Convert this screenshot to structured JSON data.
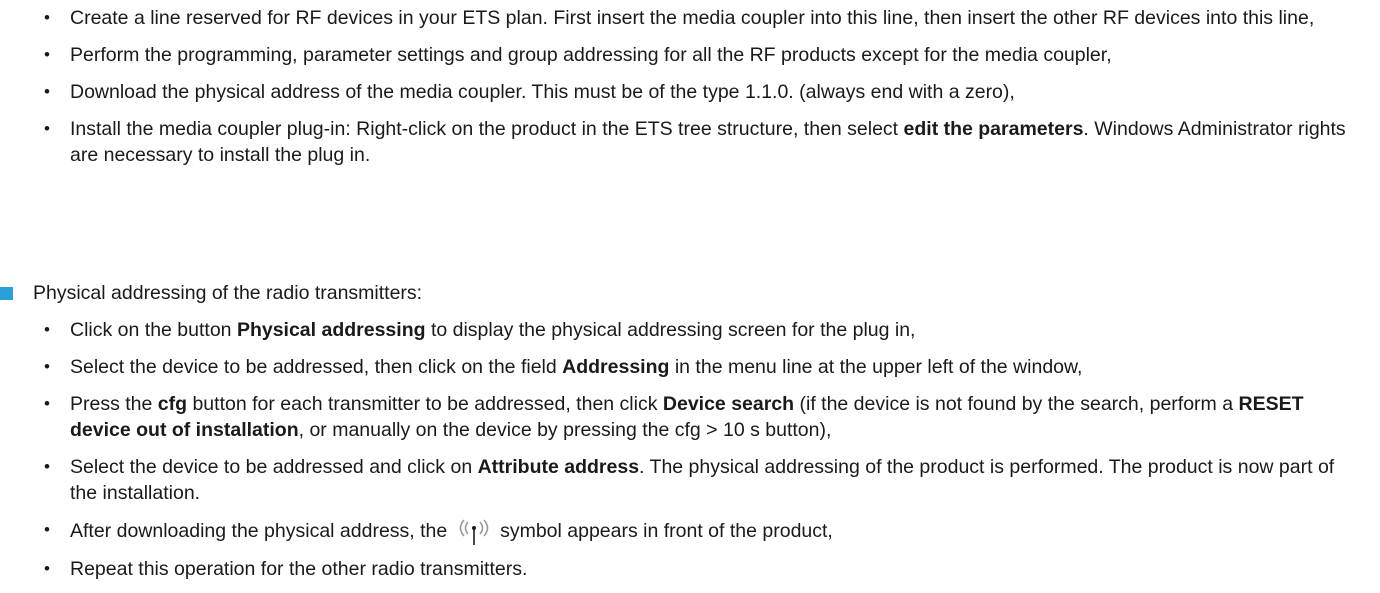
{
  "bullet_char": "•",
  "top_list": [
    {
      "parts": [
        {
          "t": "Create a line reserved for RF devices in your ETS plan. First insert the media coupler into this line, then insert the other RF devices into this line,",
          "b": false
        }
      ]
    },
    {
      "parts": [
        {
          "t": "Perform the programming, parameter settings and group addressing for all the RF products except for the media coupler,",
          "b": false
        }
      ]
    },
    {
      "parts": [
        {
          "t": "Download the physical address of the media coupler. This must be of the type 1.1.0. (always end with a zero),",
          "b": false
        }
      ]
    },
    {
      "parts": [
        {
          "t": "Install the media coupler plug-in: Right-click on the product in the ETS tree structure, then select ",
          "b": false
        },
        {
          "t": "edit the parameters",
          "b": true
        },
        {
          "t": ". Windows Administrator rights are necessary to install the plug in.",
          "b": false
        }
      ]
    }
  ],
  "section": {
    "heading": "Physical addressing of the radio transmitters:",
    "square_color": "#2a9fd8",
    "items": [
      {
        "parts": [
          {
            "t": "Click on the button ",
            "b": false
          },
          {
            "t": "Physical addressing",
            "b": true
          },
          {
            "t": " to display the physical addressing screen for the plug in,",
            "b": false
          }
        ]
      },
      {
        "parts": [
          {
            "t": "Select the device to be addressed, then click on the field ",
            "b": false
          },
          {
            "t": "Addressing",
            "b": true
          },
          {
            "t": " in the menu line at the upper left of the window,",
            "b": false
          }
        ]
      },
      {
        "parts": [
          {
            "t": "Press the ",
            "b": false
          },
          {
            "t": "cfg",
            "b": true
          },
          {
            "t": " button for each transmitter to be addressed, then click ",
            "b": false
          },
          {
            "t": "Device search",
            "b": true
          },
          {
            "t": " (if the device is not found by the search, perform a ",
            "b": false
          },
          {
            "t": "RESET device out of installation",
            "b": true
          },
          {
            "t": ", or manually on the device by pressing the cfg > 10 s button),",
            "b": false
          }
        ]
      },
      {
        "parts": [
          {
            "t": "Select the device to be addressed and click on ",
            "b": false
          },
          {
            "t": "Attribute address",
            "b": true
          },
          {
            "t": ". The physical addressing of the product is performed. The product is now part of the installation.",
            "b": false
          }
        ]
      },
      {
        "parts": [
          {
            "t": "After downloading the physical address, the",
            "b": false
          },
          {
            "icon": "radio-signal-icon"
          },
          {
            "t": "symbol appears in front of the product,",
            "b": false
          }
        ]
      },
      {
        "parts": [
          {
            "t": "Repeat this operation for the other radio transmitters.",
            "b": false
          }
        ]
      }
    ]
  }
}
